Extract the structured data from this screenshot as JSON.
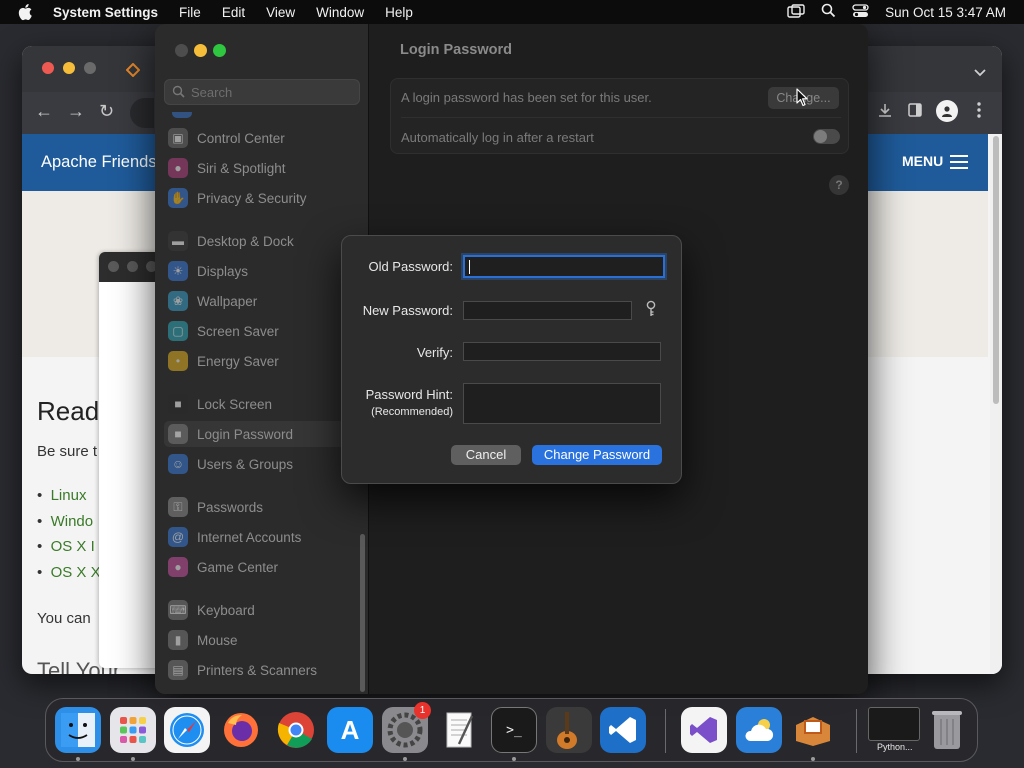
{
  "menubar": {
    "app_name": "System Settings",
    "menus": [
      "File",
      "Edit",
      "View",
      "Window",
      "Help"
    ],
    "clock": "Sun Oct 15  3:47 AM"
  },
  "background_browser": {
    "brand": "Apache Friends",
    "menu_label": "MENU",
    "heading_partial": "Readi",
    "para1_partial": "Be sure t",
    "links_partial": [
      "Linux",
      "Windo",
      "OS X I",
      "OS X X"
    ],
    "para2_partial": "You can",
    "footer_partial": "Tell Your"
  },
  "settings": {
    "search_placeholder": "Search",
    "sidebar_groups": [
      [
        {
          "label": "Control Center",
          "icon": "control-center-icon",
          "color": "#6a6a6a"
        },
        {
          "label": "Siri & Spotlight",
          "icon": "siri-icon",
          "color": "#b04080"
        },
        {
          "label": "Privacy & Security",
          "icon": "hand-icon",
          "color": "#3a7ad8"
        }
      ],
      [
        {
          "label": "Desktop & Dock",
          "icon": "dock-icon",
          "color": "#3a3a3a"
        },
        {
          "label": "Displays",
          "icon": "sun-icon",
          "color": "#3a7ad8"
        },
        {
          "label": "Wallpaper",
          "icon": "wallpaper-icon",
          "color": "#38a0c8"
        },
        {
          "label": "Screen Saver",
          "icon": "screen-saver-icon",
          "color": "#30a8b8"
        },
        {
          "label": "Energy Saver",
          "icon": "bulb-icon",
          "color": "#e0b020"
        }
      ],
      [
        {
          "label": "Lock Screen",
          "icon": "lock-icon",
          "color": "#2a2a2a"
        },
        {
          "label": "Login Password",
          "icon": "login-lock-icon",
          "color": "#7a7a7a",
          "selected": true
        },
        {
          "label": "Users & Groups",
          "icon": "users-icon",
          "color": "#3a7ad8"
        }
      ],
      [
        {
          "label": "Passwords",
          "icon": "key-icon",
          "color": "#8a8a8a"
        },
        {
          "label": "Internet Accounts",
          "icon": "at-icon",
          "color": "#3a7ad8"
        },
        {
          "label": "Game Center",
          "icon": "game-center-icon",
          "color": "#c850a0"
        }
      ],
      [
        {
          "label": "Keyboard",
          "icon": "keyboard-icon",
          "color": "#7a7a7a"
        },
        {
          "label": "Mouse",
          "icon": "mouse-icon",
          "color": "#7a7a7a"
        },
        {
          "label": "Printers & Scanners",
          "icon": "printer-icon",
          "color": "#7a7a7a"
        }
      ]
    ],
    "page_title": "Login Password",
    "password_status": "A login password has been set for this user.",
    "change_button": "Change...",
    "auto_login_label": "Automatically log in after a restart",
    "auto_login_enabled": false,
    "help_label": "?"
  },
  "dialog": {
    "old_password_label": "Old Password:",
    "new_password_label": "New Password:",
    "verify_label": "Verify:",
    "hint_label": "Password Hint:",
    "hint_sub_label": "(Recommended)",
    "old_password_value": "",
    "new_password_value": "",
    "verify_value": "",
    "hint_value": "",
    "cancel_button": "Cancel",
    "change_password_button": "Change Password",
    "accent_color": "#2a72dd"
  },
  "dock": {
    "items": [
      {
        "name": "finder-icon",
        "bg": "#2e8fe8",
        "running": true
      },
      {
        "name": "launchpad-icon",
        "bg": "#e6e6ea",
        "running": true
      },
      {
        "name": "safari-icon",
        "bg": "#f4f4f4",
        "running": false
      },
      {
        "name": "firefox-icon",
        "bg": "#3a2b6a",
        "running": false
      },
      {
        "name": "chrome-icon",
        "bg": "#f4f4f4",
        "running": false
      },
      {
        "name": "app-store-icon",
        "bg": "#1a8cf0",
        "running": false
      },
      {
        "name": "system-settings-icon",
        "bg": "#8a8a8e",
        "running": true,
        "badge": "1"
      },
      {
        "name": "textedit-icon",
        "bg": "#f4f4f4",
        "running": false
      },
      {
        "name": "terminal-icon",
        "bg": "#1a1a1a",
        "running": true
      },
      {
        "name": "garageband-icon",
        "bg": "#3a3a3a",
        "running": false
      },
      {
        "name": "vscode-icon",
        "bg": "#1e6fc8",
        "running": false
      },
      {
        "name": "visual-studio-icon",
        "bg": "#f4f4f4",
        "running": false
      },
      {
        "name": "weather-icon",
        "bg": "#2a80d8",
        "running": false
      },
      {
        "name": "xampp-icon",
        "bg": "#e8882a",
        "running": true
      },
      {
        "name": "python-window-icon",
        "bg": "#1a1a1a",
        "running": false
      },
      {
        "name": "trash-icon",
        "bg": "transparent",
        "running": false
      }
    ],
    "python_caption": "Python..."
  }
}
